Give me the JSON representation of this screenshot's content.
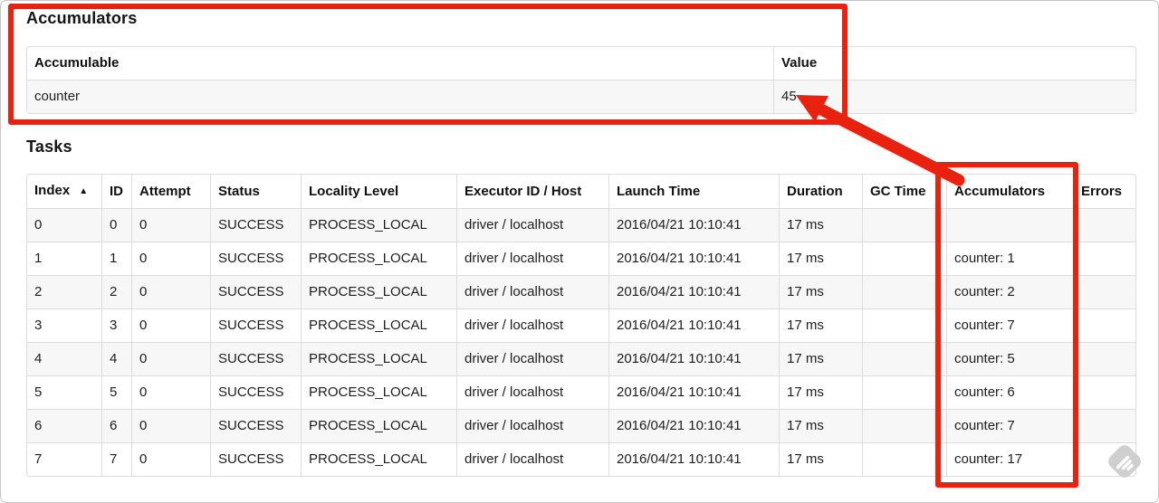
{
  "accumulators_section": {
    "title": "Accumulators",
    "table": {
      "headers": {
        "accumulable": "Accumulable",
        "value": "Value"
      },
      "rows": [
        {
          "accumulable": "counter",
          "value": "45"
        }
      ]
    }
  },
  "tasks_section": {
    "title": "Tasks",
    "table": {
      "sort_icon": "▲",
      "headers": {
        "index": "Index",
        "id": "ID",
        "attempt": "Attempt",
        "status": "Status",
        "locality": "Locality Level",
        "executor": "Executor ID / Host",
        "launch": "Launch Time",
        "duration": "Duration",
        "gc": "GC Time",
        "accumulators": "Accumulators",
        "errors": "Errors"
      },
      "rows": [
        {
          "index": "0",
          "id": "0",
          "attempt": "0",
          "status": "SUCCESS",
          "locality": "PROCESS_LOCAL",
          "executor": "driver / localhost",
          "launch": "2016/04/21 10:10:41",
          "duration": "17 ms",
          "gc": "",
          "accumulators": "",
          "errors": ""
        },
        {
          "index": "1",
          "id": "1",
          "attempt": "0",
          "status": "SUCCESS",
          "locality": "PROCESS_LOCAL",
          "executor": "driver / localhost",
          "launch": "2016/04/21 10:10:41",
          "duration": "17 ms",
          "gc": "",
          "accumulators": "counter: 1",
          "errors": ""
        },
        {
          "index": "2",
          "id": "2",
          "attempt": "0",
          "status": "SUCCESS",
          "locality": "PROCESS_LOCAL",
          "executor": "driver / localhost",
          "launch": "2016/04/21 10:10:41",
          "duration": "17 ms",
          "gc": "",
          "accumulators": "counter: 2",
          "errors": ""
        },
        {
          "index": "3",
          "id": "3",
          "attempt": "0",
          "status": "SUCCESS",
          "locality": "PROCESS_LOCAL",
          "executor": "driver / localhost",
          "launch": "2016/04/21 10:10:41",
          "duration": "17 ms",
          "gc": "",
          "accumulators": "counter: 7",
          "errors": ""
        },
        {
          "index": "4",
          "id": "4",
          "attempt": "0",
          "status": "SUCCESS",
          "locality": "PROCESS_LOCAL",
          "executor": "driver / localhost",
          "launch": "2016/04/21 10:10:41",
          "duration": "17 ms",
          "gc": "",
          "accumulators": "counter: 5",
          "errors": ""
        },
        {
          "index": "5",
          "id": "5",
          "attempt": "0",
          "status": "SUCCESS",
          "locality": "PROCESS_LOCAL",
          "executor": "driver / localhost",
          "launch": "2016/04/21 10:10:41",
          "duration": "17 ms",
          "gc": "",
          "accumulators": "counter: 6",
          "errors": ""
        },
        {
          "index": "6",
          "id": "6",
          "attempt": "0",
          "status": "SUCCESS",
          "locality": "PROCESS_LOCAL",
          "executor": "driver / localhost",
          "launch": "2016/04/21 10:10:41",
          "duration": "17 ms",
          "gc": "",
          "accumulators": "counter: 7",
          "errors": ""
        },
        {
          "index": "7",
          "id": "7",
          "attempt": "0",
          "status": "SUCCESS",
          "locality": "PROCESS_LOCAL",
          "executor": "driver / localhost",
          "launch": "2016/04/21 10:10:41",
          "duration": "17 ms",
          "gc": "",
          "accumulators": "counter: 17",
          "errors": ""
        }
      ]
    }
  },
  "annotations": {
    "highlight_color": "#e8220f"
  }
}
